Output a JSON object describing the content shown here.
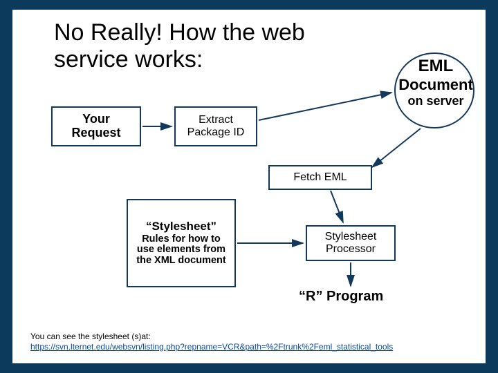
{
  "title": "No Really! How the web service works:",
  "eml": {
    "l1": "EML",
    "l2": "Document",
    "l3": "on server"
  },
  "your_request": {
    "l1": "Your",
    "l2": "Request"
  },
  "extract_pkg": {
    "l1": "Extract",
    "l2": "Package ID"
  },
  "fetch_eml": "Fetch EML",
  "stylesheet": {
    "heading": "“Stylesheet”",
    "body": "Rules for how to use elements from the XML document"
  },
  "styleproc": {
    "l1": "Stylesheet",
    "l2": "Processor"
  },
  "rprog": "“R” Program",
  "footnote_intro": "You can see the stylesheet (s)at:",
  "footnote_link": "https://svn.lternet.edu/websvn/listing.php?repname=VCR&path=%2Ftrunk%2Feml_statistical_tools",
  "colors": {
    "bg": "#0b3a5c",
    "border": "#12395b",
    "link": "#0b4aa0"
  }
}
